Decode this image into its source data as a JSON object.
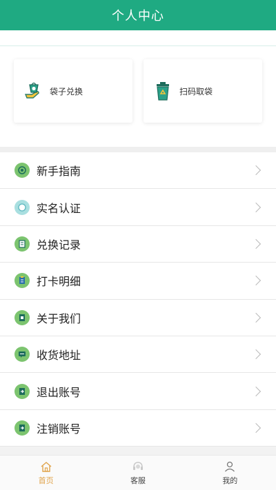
{
  "header": {
    "title": "个人中心"
  },
  "cards": [
    {
      "label": "袋子兑换",
      "icon": "bag-exchange-icon"
    },
    {
      "label": "扫码取袋",
      "icon": "recycle-bin-icon"
    }
  ],
  "menu": [
    {
      "label": "新手指南",
      "icon": "guide-icon"
    },
    {
      "label": "实名认证",
      "icon": "verify-icon"
    },
    {
      "label": "兑换记录",
      "icon": "record-icon"
    },
    {
      "label": "打卡明细",
      "icon": "checkin-icon"
    },
    {
      "label": "关于我们",
      "icon": "about-icon"
    },
    {
      "label": "收货地址",
      "icon": "address-icon"
    },
    {
      "label": "退出账号",
      "icon": "logout-icon"
    },
    {
      "label": "注销账号",
      "icon": "deactivate-icon"
    }
  ],
  "tabs": [
    {
      "label": "首页",
      "icon": "home-icon",
      "active": true
    },
    {
      "label": "客服",
      "icon": "service-icon",
      "active": false
    },
    {
      "label": "我的",
      "icon": "user-icon",
      "active": false
    }
  ],
  "colors": {
    "primary": "#1faa82",
    "icon_green": "#7cc46f",
    "tab_active": "#e0a34a"
  }
}
